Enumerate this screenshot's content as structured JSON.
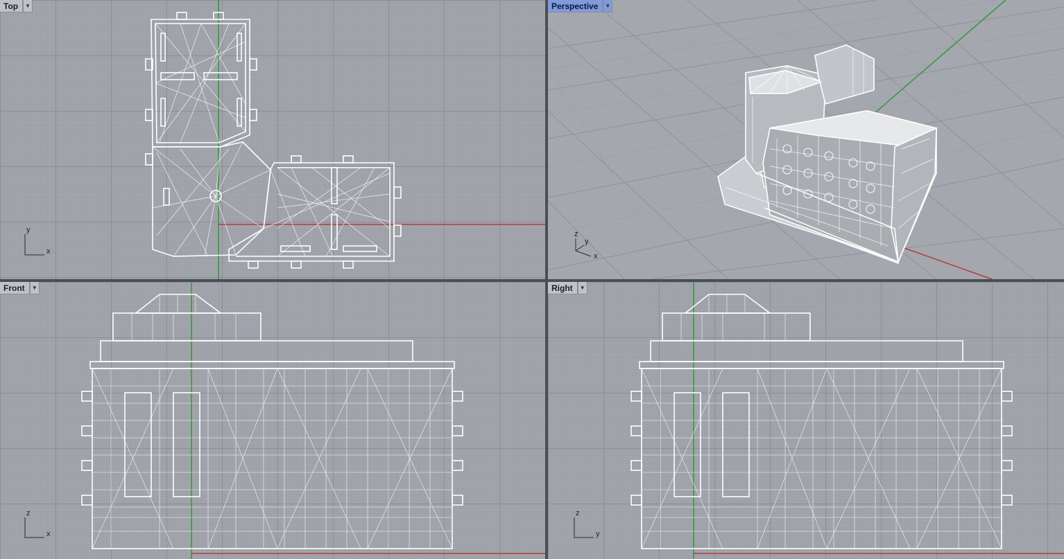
{
  "viewports": {
    "top": {
      "label": "Top",
      "axis_h": "x",
      "axis_v": "y"
    },
    "perspective": {
      "label": "Perspective",
      "axis_a": "x",
      "axis_b": "y",
      "axis_v": "z"
    },
    "front": {
      "label": "Front",
      "axis_h": "x",
      "axis_v": "z"
    },
    "right": {
      "label": "Right",
      "axis_h": "y",
      "axis_v": "z"
    }
  },
  "active_viewport": "perspective",
  "colors": {
    "grid_bg": "#9fa3a9",
    "grid_major": "#8c9096",
    "wireframe": "#ffffff",
    "axis_x": "#b83a3a",
    "axis_y": "#2f9a3a",
    "label_active": "#7f9bdc",
    "label_inactive": "#bfc2c6"
  },
  "icons": {
    "viewport_menu": "triangle-down-icon"
  }
}
